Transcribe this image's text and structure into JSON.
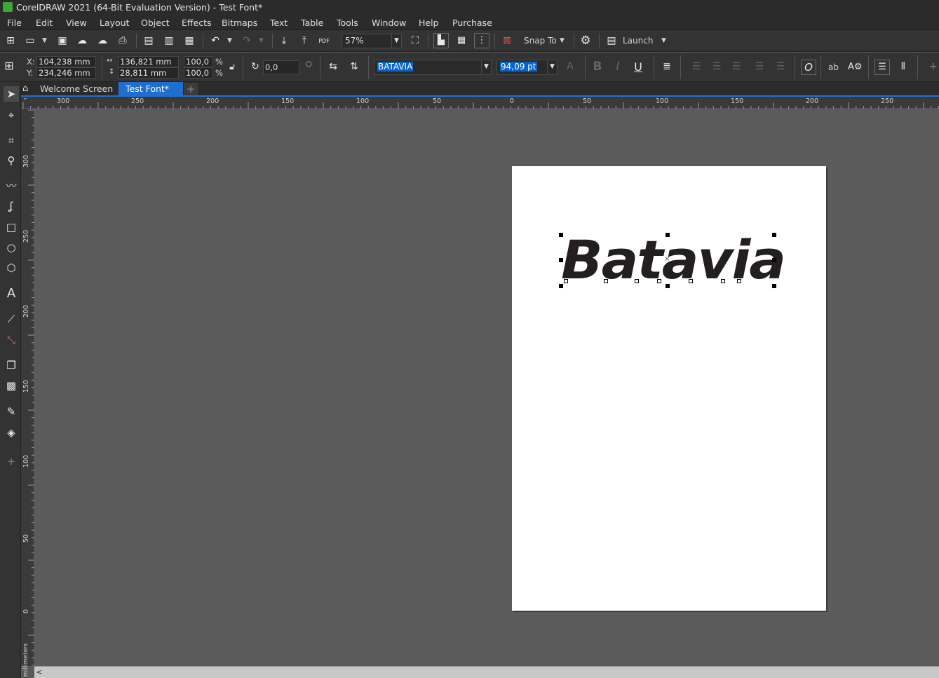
{
  "window": {
    "title": "CorelDRAW 2021 (64-Bit Evaluation Version) - Test Font*"
  },
  "menu": [
    "File",
    "Edit",
    "View",
    "Layout",
    "Object",
    "Effects",
    "Bitmaps",
    "Text",
    "Table",
    "Tools",
    "Window",
    "Help",
    "Purchase"
  ],
  "toolbar": {
    "zoom_value": "57%",
    "snap_label": "Snap To",
    "launch_label": "Launch",
    "pdf_label": "PDF"
  },
  "propbar": {
    "x_label": "X:",
    "x_value": "104,238 mm",
    "y_label": "Y:",
    "y_value": "234,246 mm",
    "w_value": "136,821 mm",
    "h_value": "28,811 mm",
    "scale_w": "100,0",
    "scale_h": "100,0",
    "pct": "%",
    "angle": "0,0",
    "font_name": "BATAVIA",
    "font_size": "94,09 pt",
    "underline_label": "U",
    "bold_label": "B",
    "italic_label": "I",
    "ab_label": "ab"
  },
  "tabs": [
    {
      "label": "Welcome Screen",
      "active": false
    },
    {
      "label": "Test Font*",
      "active": true
    }
  ],
  "ruler": {
    "h_labels": [
      "300",
      "250",
      "200",
      "150",
      "100",
      "50",
      "0",
      "50",
      "100",
      "150",
      "200",
      "250"
    ],
    "v_labels": [
      "300",
      "250",
      "200",
      "150",
      "100",
      "50",
      "0"
    ],
    "unit": "millimeters"
  },
  "document": {
    "artistic_text": "Batavia"
  },
  "colors": {
    "accent": "#1f6fd1",
    "highlight": "#0a64c8",
    "page": "#ffffff",
    "desktop": "#5b5b5b"
  },
  "icons": [
    "new-document-icon",
    "open-icon",
    "save-icon",
    "upload-icon",
    "export-cloud-icon",
    "print-icon",
    "undo-icon",
    "redo-icon",
    "import-icon",
    "export-icon",
    "full-screen-icon",
    "gear-icon",
    "pick-tool-icon",
    "shape-tool-icon",
    "crop-tool-icon",
    "zoom-tool-icon",
    "freehand-tool-icon",
    "artistic-media-icon",
    "rectangle-tool-icon",
    "ellipse-tool-icon",
    "polygon-tool-icon",
    "text-tool-icon",
    "dimension-tool-icon",
    "connector-tool-icon",
    "drop-shadow-icon",
    "transparency-icon",
    "eyedropper-icon",
    "fill-icon",
    "add-tool-icon",
    "home-icon"
  ]
}
